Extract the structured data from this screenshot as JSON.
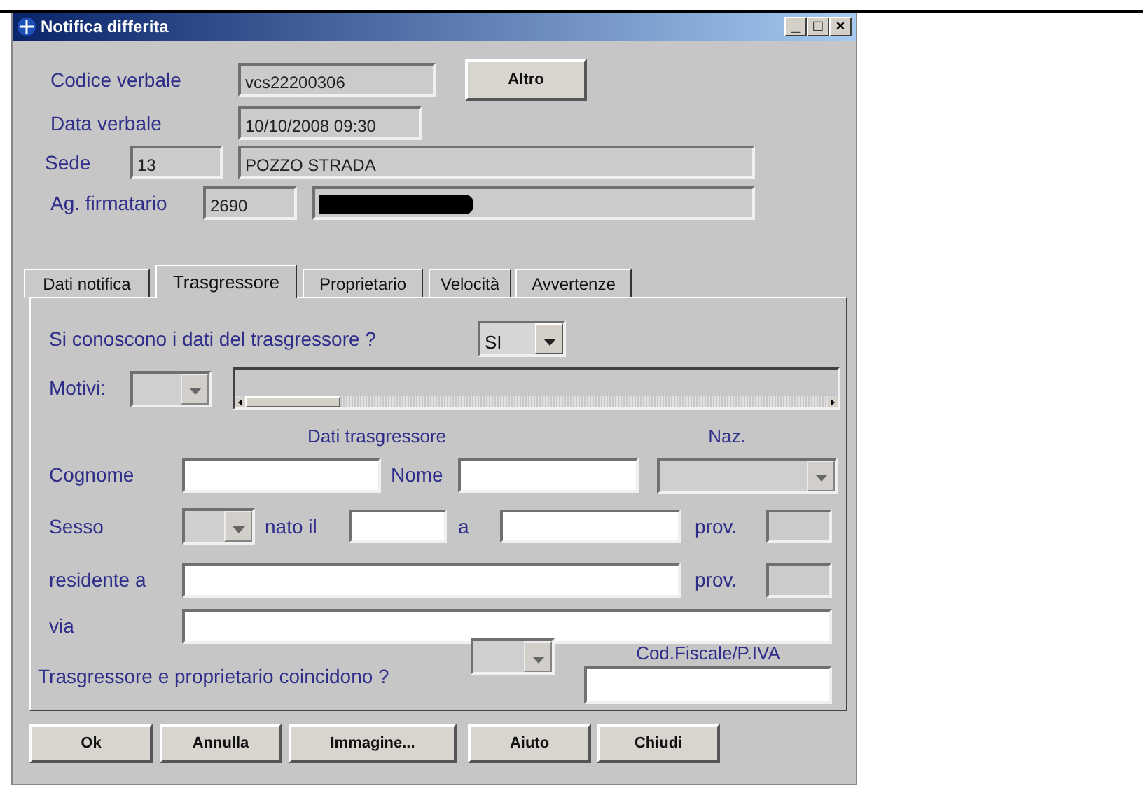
{
  "window": {
    "title": "Notifica differita",
    "controls": [
      "_",
      "□",
      "×"
    ]
  },
  "header": [
    {
      "label": "Codice verbale",
      "fields": [
        {
          "value": "vcs22200306"
        }
      ],
      "button": "Altro"
    },
    {
      "label": "Data verbale",
      "fields": [
        {
          "value": "10/10/2008 09:30"
        }
      ]
    },
    {
      "label": "Sede",
      "fields": [
        {
          "value": "13"
        },
        {
          "value": "POZZO STRADA"
        }
      ]
    },
    {
      "label": "Ag. firmatario",
      "fields": [
        {
          "value": "2690"
        },
        {
          "redacted": true
        }
      ]
    }
  ],
  "tabs": [
    {
      "label": "Dati notifica",
      "selected": false
    },
    {
      "label": "Trasgressore",
      "selected": true
    },
    {
      "label": "Proprietario",
      "selected": false
    },
    {
      "label": "Velocità",
      "selected": false
    },
    {
      "label": "Avvertenze",
      "selected": false
    }
  ],
  "form_rows": [
    [
      {
        "kind": "label",
        "text": "Si conoscono i dati del trasgressore ?"
      },
      {
        "kind": "combo",
        "value": "SI",
        "disabled": false
      }
    ],
    [
      {
        "kind": "label",
        "text": "Motivi:"
      },
      {
        "kind": "combo",
        "disabled": true
      },
      {
        "kind": "listbox"
      }
    ],
    [
      {
        "kind": "heading",
        "text": "Dati trasgressore"
      },
      {
        "kind": "heading",
        "text": "Naz."
      }
    ],
    [
      {
        "kind": "label",
        "text": "Cognome"
      },
      {
        "kind": "field",
        "disabled": false
      },
      {
        "kind": "label",
        "text": "Nome"
      },
      {
        "kind": "field",
        "disabled": false
      },
      {
        "kind": "combo",
        "disabled": true
      }
    ],
    [
      {
        "kind": "label",
        "text": "Sesso"
      },
      {
        "kind": "combo",
        "disabled": true
      },
      {
        "kind": "label",
        "text": "nato il"
      },
      {
        "kind": "field",
        "disabled": false
      },
      {
        "kind": "label",
        "text": "a"
      },
      {
        "kind": "field",
        "disabled": false
      },
      {
        "kind": "label",
        "text": "prov."
      },
      {
        "kind": "field",
        "disabled": true
      }
    ],
    [
      {
        "kind": "label",
        "text": "residente a"
      },
      {
        "kind": "field",
        "disabled": false
      },
      {
        "kind": "label",
        "text": "prov."
      },
      {
        "kind": "field",
        "disabled": true
      }
    ],
    [
      {
        "kind": "label",
        "text": "via"
      },
      {
        "kind": "field",
        "disabled": false
      }
    ],
    [
      {
        "kind": "label",
        "text": "Trasgressore e proprietario coincidono ?"
      },
      {
        "kind": "combo",
        "disabled": true
      },
      {
        "kind": "field",
        "caption": "Cod.Fiscale/P.IVA",
        "disabled": false
      }
    ]
  ],
  "buttons": [
    "Ok",
    "Annulla",
    "Immagine...",
    "Aiuto",
    "Chiudi"
  ]
}
